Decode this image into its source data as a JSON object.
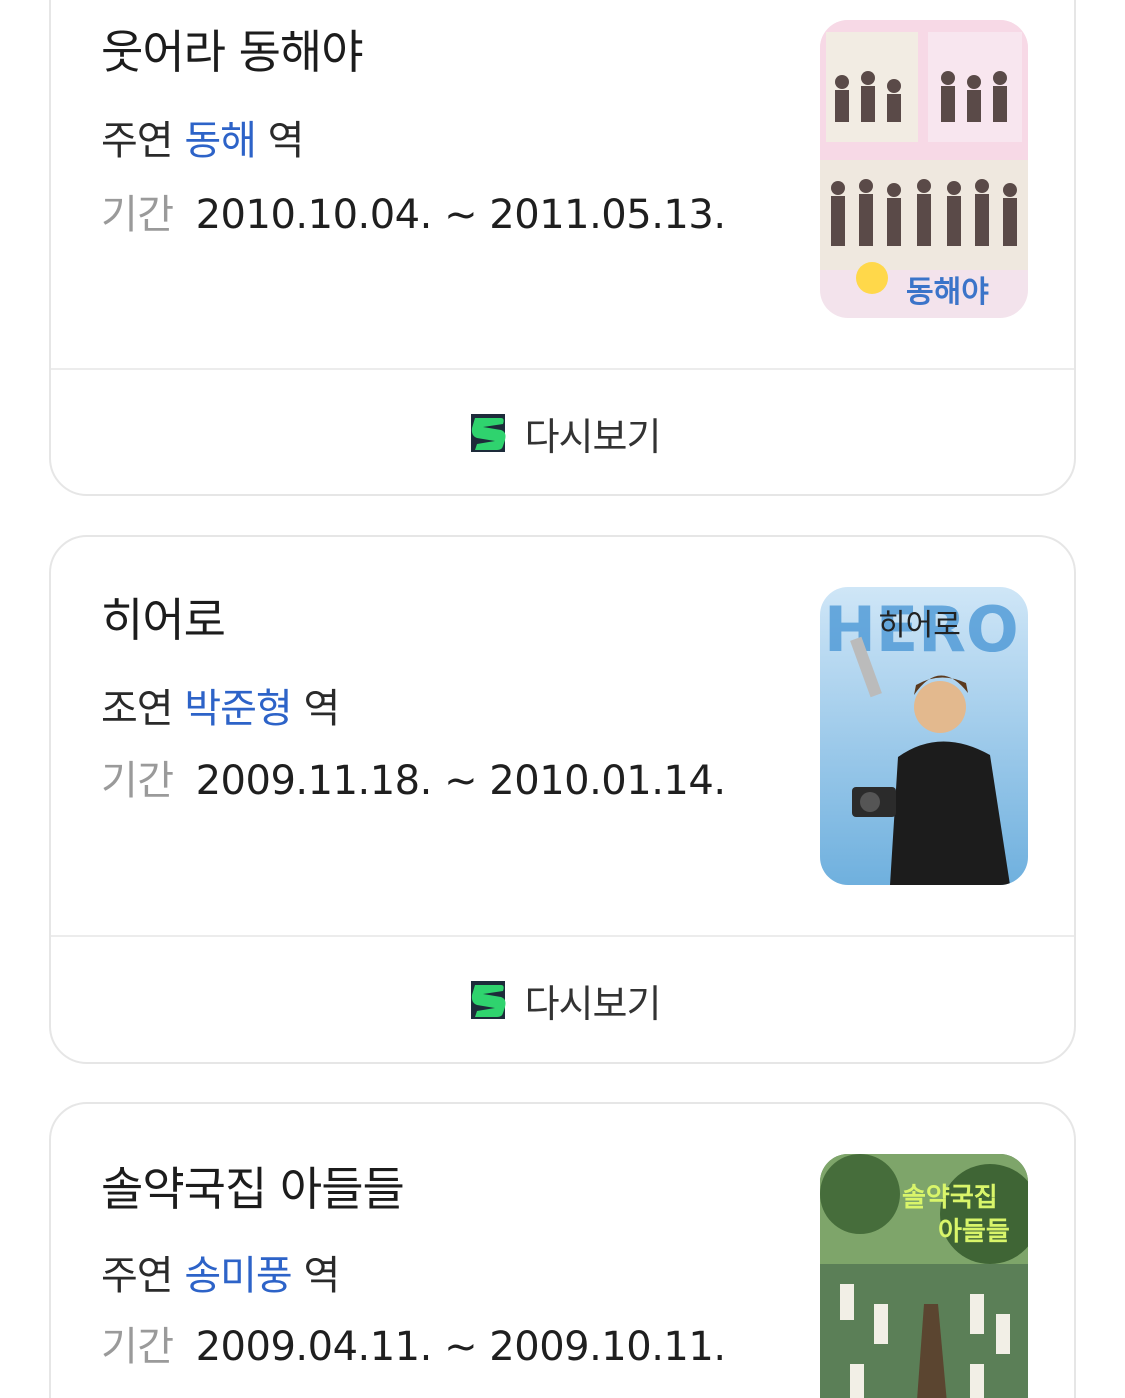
{
  "cards": [
    {
      "title": "웃어라 동해야",
      "role_type": "주연",
      "actor": "동해",
      "role_suffix": "역",
      "period_label": "기간",
      "period": "2010.10.04. ~ 2011.05.13.",
      "rewatch_label": "다시보기",
      "poster_text": "동해야"
    },
    {
      "title": "히어로",
      "role_type": "조연",
      "actor": "박준형",
      "role_suffix": "역",
      "period_label": "기간",
      "period": "2009.11.18. ~ 2010.01.14.",
      "rewatch_label": "다시보기",
      "poster_text": "히어로"
    },
    {
      "title": "솔약국집 아들들",
      "role_type": "주연",
      "actor": "송미풍",
      "role_suffix": "역",
      "period_label": "기간",
      "period": "2009.04.11. ~ 2009.10.11.",
      "poster_text": "솔약국집 아들들"
    }
  ],
  "colors": {
    "actor_link": "#2d63c8",
    "label_gray": "#9a9a9a",
    "icon_green": "#2fd36e",
    "icon_dark": "#1d2b3a"
  },
  "icons": {
    "rewatch": "play-service-s-icon"
  }
}
